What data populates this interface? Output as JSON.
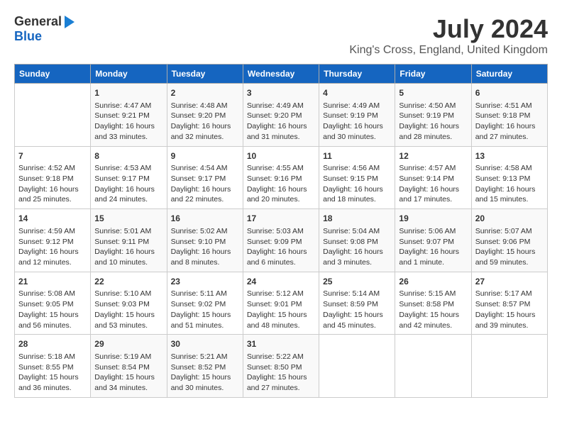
{
  "header": {
    "logo_general": "General",
    "logo_blue": "Blue",
    "month": "July 2024",
    "location": "King's Cross, England, United Kingdom"
  },
  "weekdays": [
    "Sunday",
    "Monday",
    "Tuesday",
    "Wednesday",
    "Thursday",
    "Friday",
    "Saturday"
  ],
  "weeks": [
    [
      {
        "day": "",
        "lines": []
      },
      {
        "day": "1",
        "lines": [
          "Sunrise: 4:47 AM",
          "Sunset: 9:21 PM",
          "Daylight: 16 hours",
          "and 33 minutes."
        ]
      },
      {
        "day": "2",
        "lines": [
          "Sunrise: 4:48 AM",
          "Sunset: 9:20 PM",
          "Daylight: 16 hours",
          "and 32 minutes."
        ]
      },
      {
        "day": "3",
        "lines": [
          "Sunrise: 4:49 AM",
          "Sunset: 9:20 PM",
          "Daylight: 16 hours",
          "and 31 minutes."
        ]
      },
      {
        "day": "4",
        "lines": [
          "Sunrise: 4:49 AM",
          "Sunset: 9:19 PM",
          "Daylight: 16 hours",
          "and 30 minutes."
        ]
      },
      {
        "day": "5",
        "lines": [
          "Sunrise: 4:50 AM",
          "Sunset: 9:19 PM",
          "Daylight: 16 hours",
          "and 28 minutes."
        ]
      },
      {
        "day": "6",
        "lines": [
          "Sunrise: 4:51 AM",
          "Sunset: 9:18 PM",
          "Daylight: 16 hours",
          "and 27 minutes."
        ]
      }
    ],
    [
      {
        "day": "7",
        "lines": [
          "Sunrise: 4:52 AM",
          "Sunset: 9:18 PM",
          "Daylight: 16 hours",
          "and 25 minutes."
        ]
      },
      {
        "day": "8",
        "lines": [
          "Sunrise: 4:53 AM",
          "Sunset: 9:17 PM",
          "Daylight: 16 hours",
          "and 24 minutes."
        ]
      },
      {
        "day": "9",
        "lines": [
          "Sunrise: 4:54 AM",
          "Sunset: 9:17 PM",
          "Daylight: 16 hours",
          "and 22 minutes."
        ]
      },
      {
        "day": "10",
        "lines": [
          "Sunrise: 4:55 AM",
          "Sunset: 9:16 PM",
          "Daylight: 16 hours",
          "and 20 minutes."
        ]
      },
      {
        "day": "11",
        "lines": [
          "Sunrise: 4:56 AM",
          "Sunset: 9:15 PM",
          "Daylight: 16 hours",
          "and 18 minutes."
        ]
      },
      {
        "day": "12",
        "lines": [
          "Sunrise: 4:57 AM",
          "Sunset: 9:14 PM",
          "Daylight: 16 hours",
          "and 17 minutes."
        ]
      },
      {
        "day": "13",
        "lines": [
          "Sunrise: 4:58 AM",
          "Sunset: 9:13 PM",
          "Daylight: 16 hours",
          "and 15 minutes."
        ]
      }
    ],
    [
      {
        "day": "14",
        "lines": [
          "Sunrise: 4:59 AM",
          "Sunset: 9:12 PM",
          "Daylight: 16 hours",
          "and 12 minutes."
        ]
      },
      {
        "day": "15",
        "lines": [
          "Sunrise: 5:01 AM",
          "Sunset: 9:11 PM",
          "Daylight: 16 hours",
          "and 10 minutes."
        ]
      },
      {
        "day": "16",
        "lines": [
          "Sunrise: 5:02 AM",
          "Sunset: 9:10 PM",
          "Daylight: 16 hours",
          "and 8 minutes."
        ]
      },
      {
        "day": "17",
        "lines": [
          "Sunrise: 5:03 AM",
          "Sunset: 9:09 PM",
          "Daylight: 16 hours",
          "and 6 minutes."
        ]
      },
      {
        "day": "18",
        "lines": [
          "Sunrise: 5:04 AM",
          "Sunset: 9:08 PM",
          "Daylight: 16 hours",
          "and 3 minutes."
        ]
      },
      {
        "day": "19",
        "lines": [
          "Sunrise: 5:06 AM",
          "Sunset: 9:07 PM",
          "Daylight: 16 hours",
          "and 1 minute."
        ]
      },
      {
        "day": "20",
        "lines": [
          "Sunrise: 5:07 AM",
          "Sunset: 9:06 PM",
          "Daylight: 15 hours",
          "and 59 minutes."
        ]
      }
    ],
    [
      {
        "day": "21",
        "lines": [
          "Sunrise: 5:08 AM",
          "Sunset: 9:05 PM",
          "Daylight: 15 hours",
          "and 56 minutes."
        ]
      },
      {
        "day": "22",
        "lines": [
          "Sunrise: 5:10 AM",
          "Sunset: 9:03 PM",
          "Daylight: 15 hours",
          "and 53 minutes."
        ]
      },
      {
        "day": "23",
        "lines": [
          "Sunrise: 5:11 AM",
          "Sunset: 9:02 PM",
          "Daylight: 15 hours",
          "and 51 minutes."
        ]
      },
      {
        "day": "24",
        "lines": [
          "Sunrise: 5:12 AM",
          "Sunset: 9:01 PM",
          "Daylight: 15 hours",
          "and 48 minutes."
        ]
      },
      {
        "day": "25",
        "lines": [
          "Sunrise: 5:14 AM",
          "Sunset: 8:59 PM",
          "Daylight: 15 hours",
          "and 45 minutes."
        ]
      },
      {
        "day": "26",
        "lines": [
          "Sunrise: 5:15 AM",
          "Sunset: 8:58 PM",
          "Daylight: 15 hours",
          "and 42 minutes."
        ]
      },
      {
        "day": "27",
        "lines": [
          "Sunrise: 5:17 AM",
          "Sunset: 8:57 PM",
          "Daylight: 15 hours",
          "and 39 minutes."
        ]
      }
    ],
    [
      {
        "day": "28",
        "lines": [
          "Sunrise: 5:18 AM",
          "Sunset: 8:55 PM",
          "Daylight: 15 hours",
          "and 36 minutes."
        ]
      },
      {
        "day": "29",
        "lines": [
          "Sunrise: 5:19 AM",
          "Sunset: 8:54 PM",
          "Daylight: 15 hours",
          "and 34 minutes."
        ]
      },
      {
        "day": "30",
        "lines": [
          "Sunrise: 5:21 AM",
          "Sunset: 8:52 PM",
          "Daylight: 15 hours",
          "and 30 minutes."
        ]
      },
      {
        "day": "31",
        "lines": [
          "Sunrise: 5:22 AM",
          "Sunset: 8:50 PM",
          "Daylight: 15 hours",
          "and 27 minutes."
        ]
      },
      {
        "day": "",
        "lines": []
      },
      {
        "day": "",
        "lines": []
      },
      {
        "day": "",
        "lines": []
      }
    ]
  ]
}
